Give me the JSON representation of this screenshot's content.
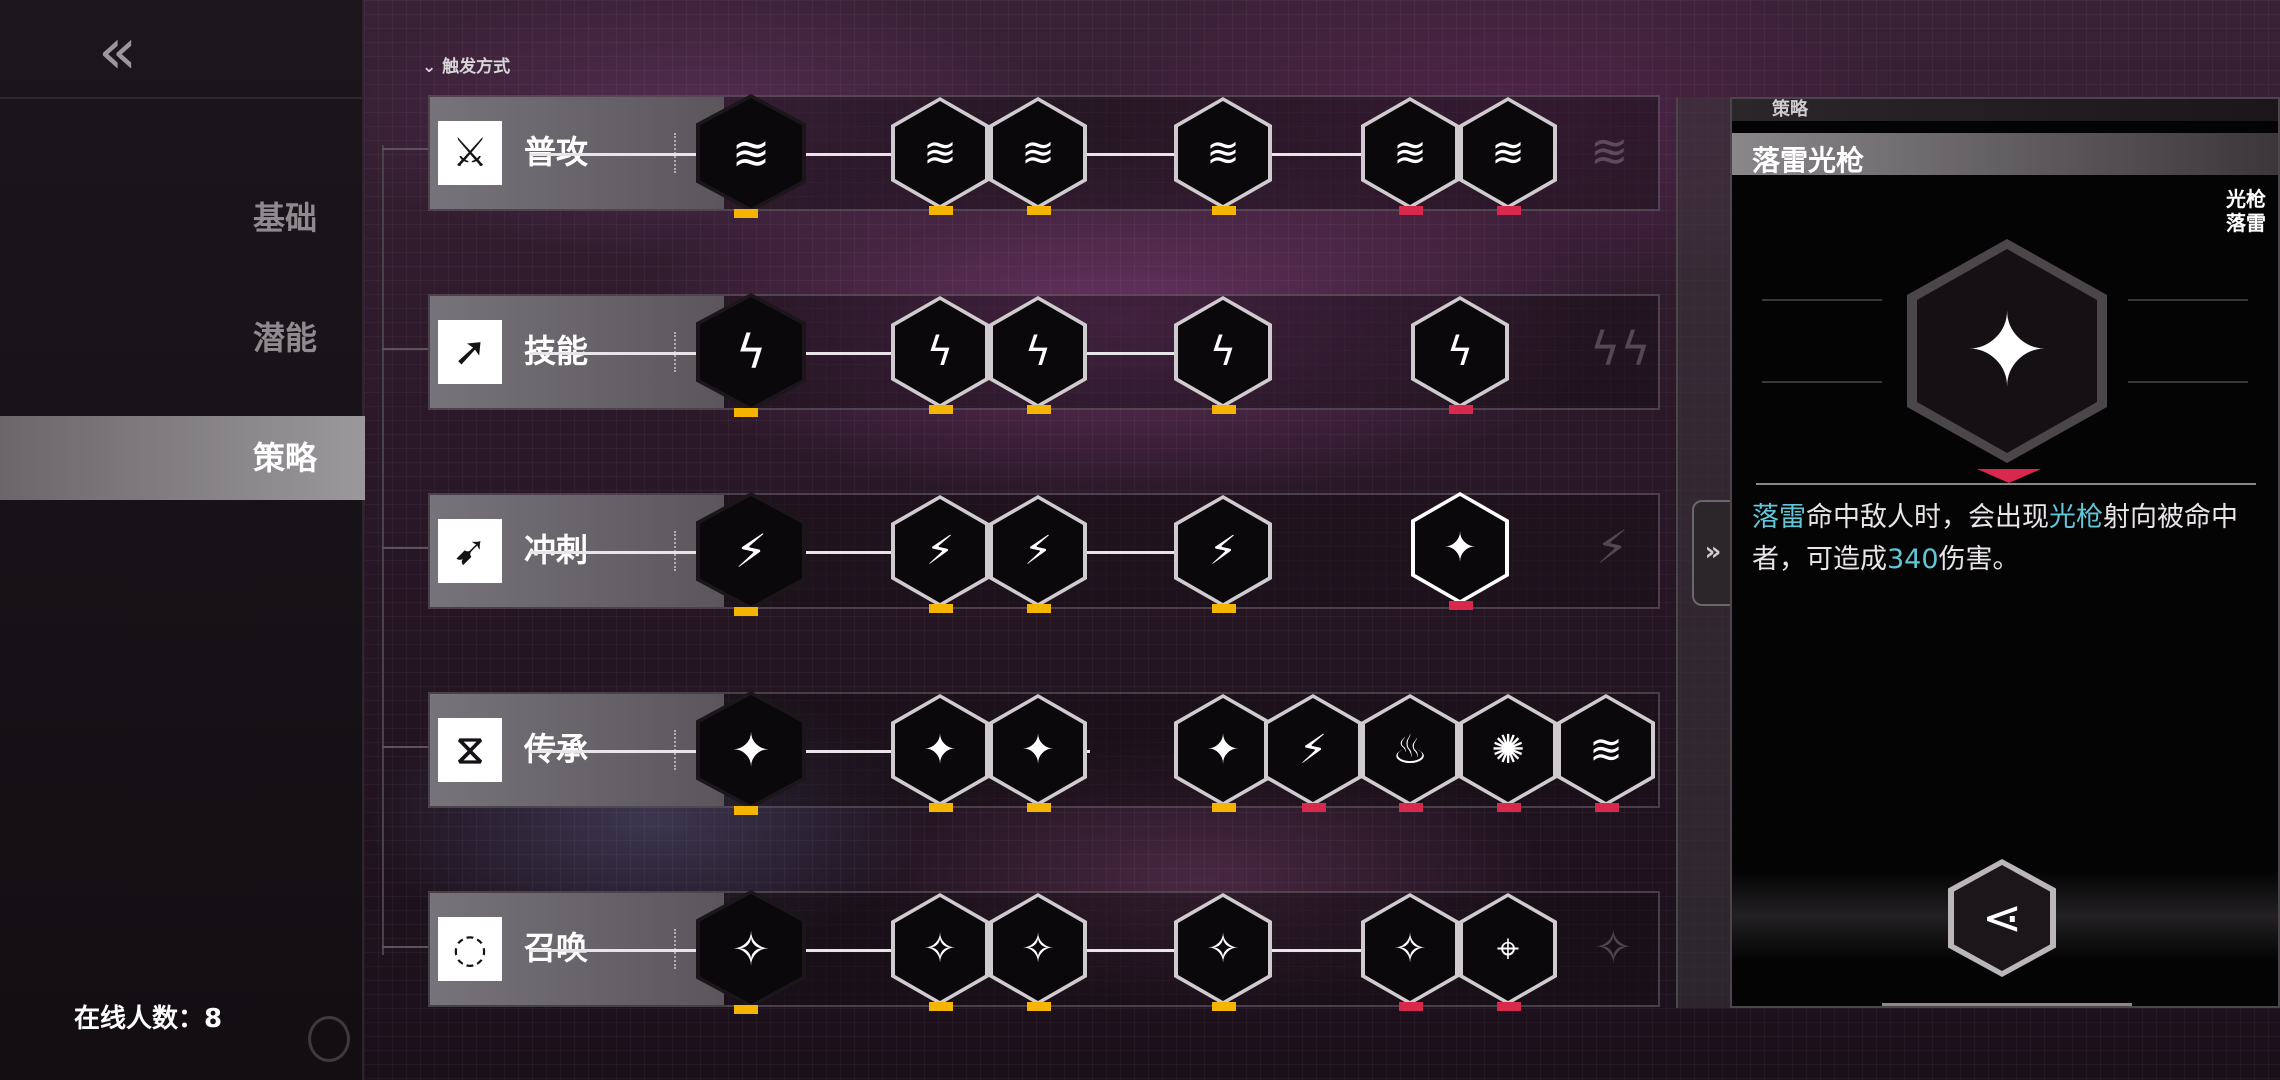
{
  "nav": {
    "back_icon": "double-chevron-left-icon",
    "items": [
      {
        "label": "基础",
        "active": false
      },
      {
        "label": "潜能",
        "active": false
      },
      {
        "label": "策略",
        "active": true
      }
    ],
    "online_label": "在线人数：8"
  },
  "trigger_header": "触发方式",
  "rows": [
    {
      "label": "普攻",
      "icon": "crossed-swords-icon"
    },
    {
      "label": "技能",
      "icon": "arrow-up-right-icon"
    },
    {
      "label": "冲刺",
      "icon": "dash-icon"
    },
    {
      "label": "传承",
      "icon": "hourglass-icon"
    },
    {
      "label": "召唤",
      "icon": "summon-icon"
    }
  ],
  "detail": {
    "section_label": "策略",
    "title": "落雷光枪",
    "tags": [
      "光枪",
      "落雷"
    ],
    "description_parts": [
      {
        "text": "落雷",
        "highlight": true
      },
      {
        "text": "命中敌人时，会出现",
        "highlight": false
      },
      {
        "text": "光枪",
        "highlight": true
      },
      {
        "text": "射向被命中者，可造成",
        "highlight": false
      },
      {
        "text": "340",
        "highlight": true
      },
      {
        "text": "伤害。",
        "highlight": false
      }
    ],
    "share_icon": "share-icon",
    "collapse_icon": "double-chevron-right-icon"
  },
  "colors": {
    "highlight": "#5fc7d8",
    "mark_yellow": "#f4b400",
    "mark_red": "#d8284c"
  }
}
